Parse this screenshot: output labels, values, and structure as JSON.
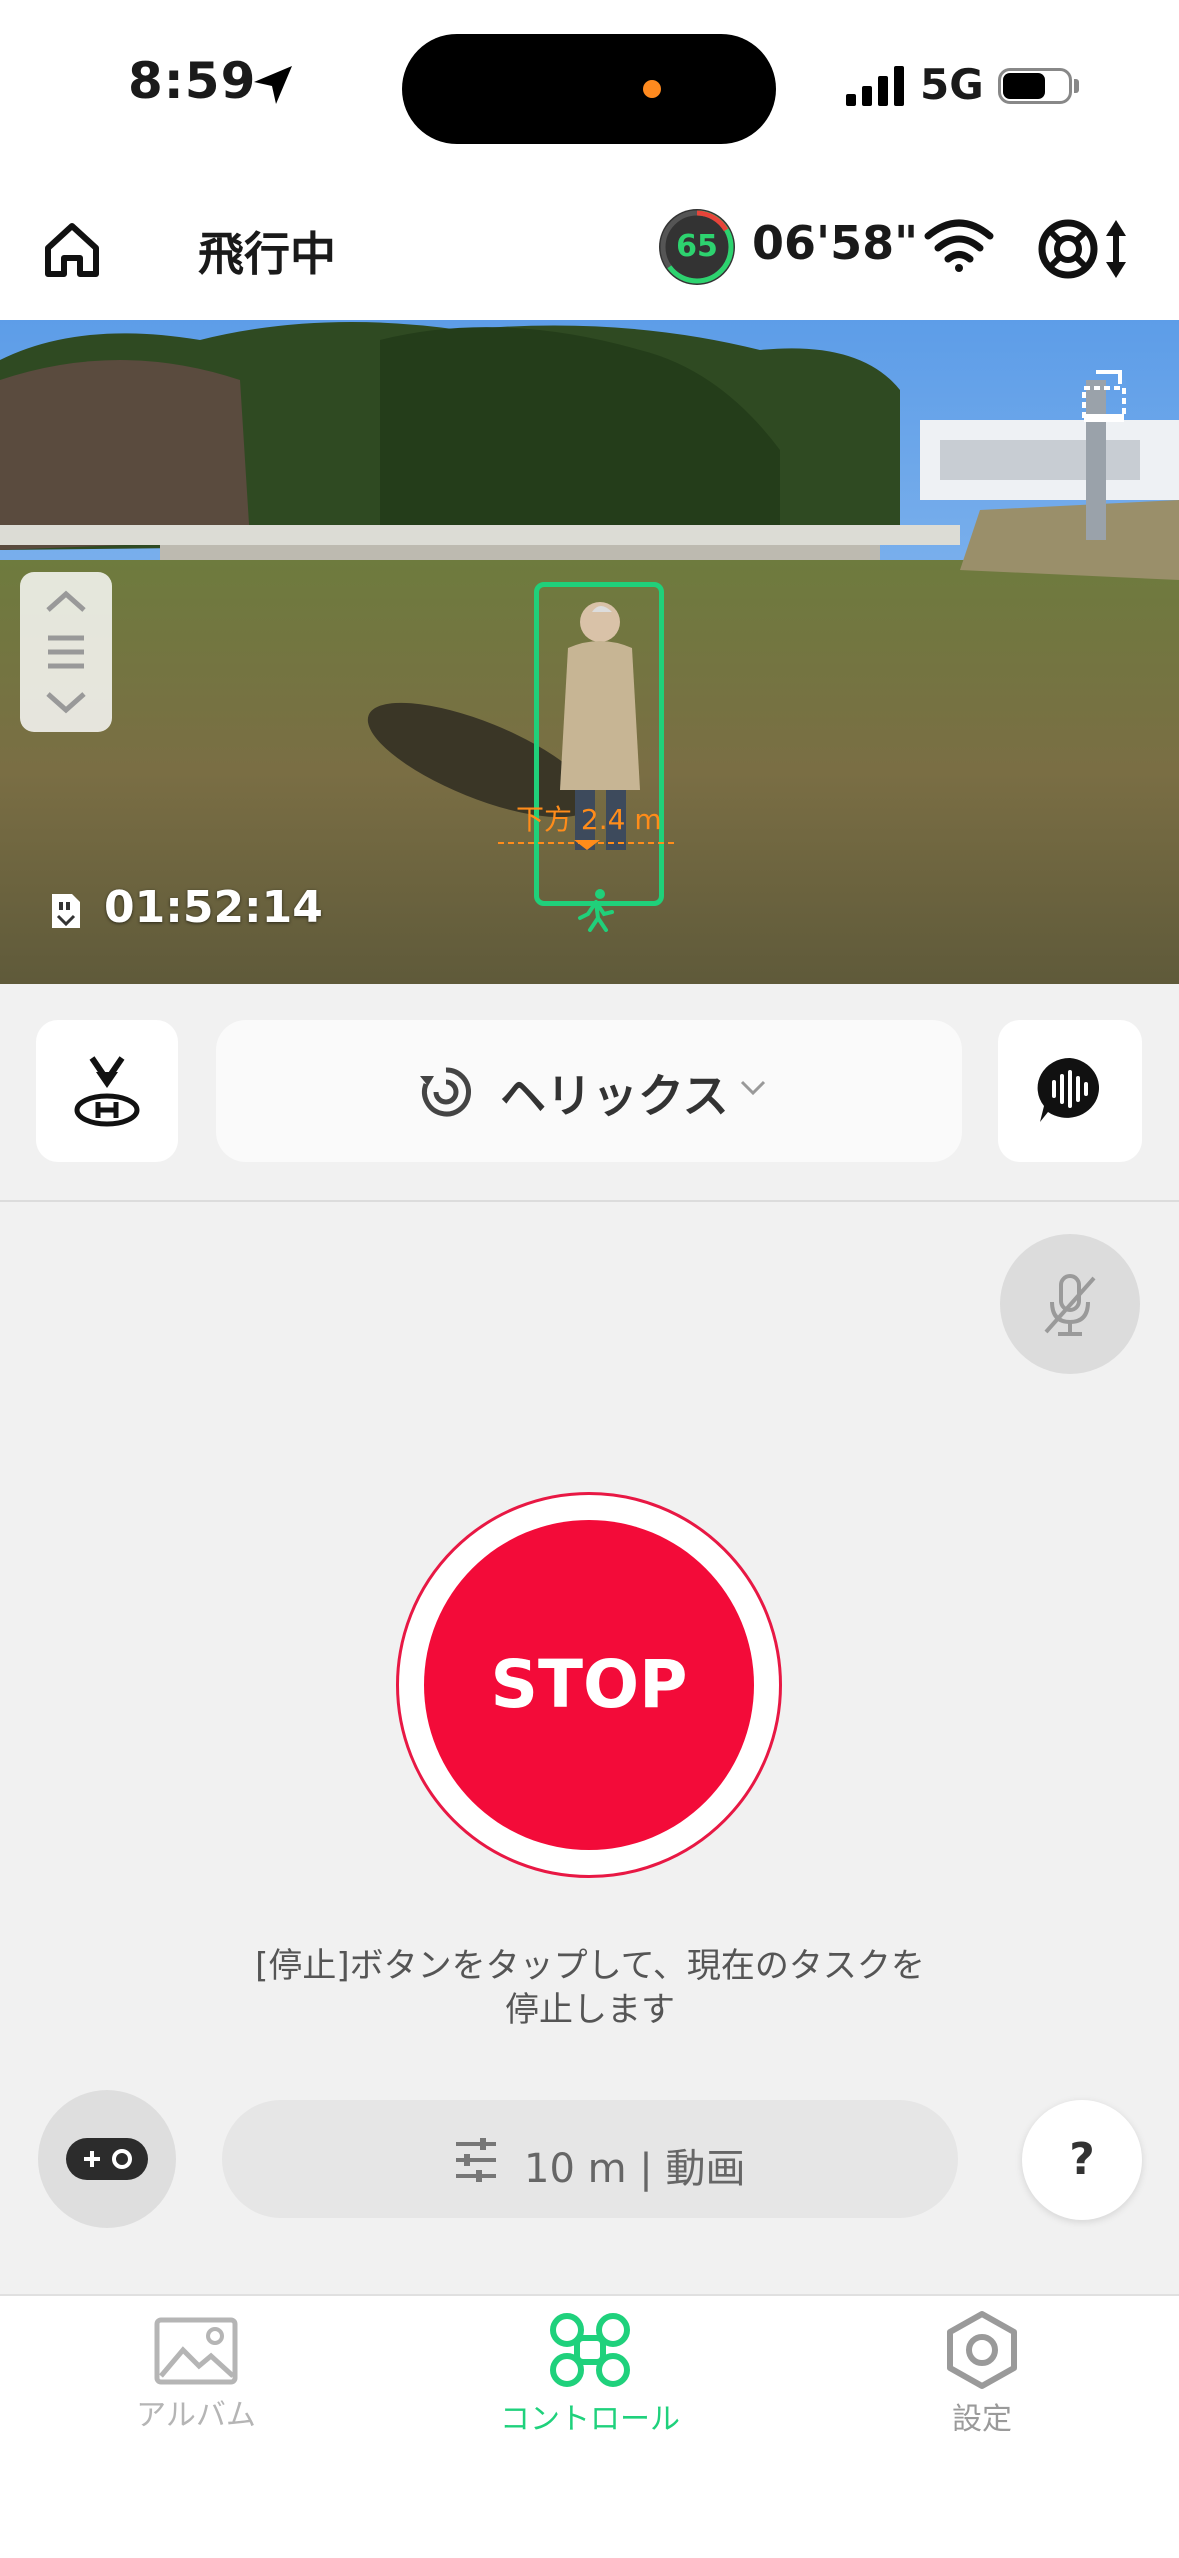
{
  "status_bar": {
    "time": "8:59",
    "network": "5G",
    "location_icon": "location-arrow-icon",
    "signal_icon": "cellular-signal-icon",
    "battery_icon": "battery-icon"
  },
  "header": {
    "flight_status": "飛行中",
    "battery_percent": "65",
    "battery_level": 0.65,
    "flight_time": "06'58\"",
    "home_icon": "home-icon",
    "wifi_icon": "wifi-icon",
    "gimbal_icon": "gimbal-control-icon"
  },
  "camera": {
    "distance_label": "下方 2.4 m",
    "recording_time": "01:52:14",
    "tracking_color": "#20d07a"
  },
  "mode_row": {
    "mode_label": "ヘリックス",
    "landing_icon": "landing-icon",
    "voice_icon": "voice-command-icon",
    "chevron_icon": "chevron-down-icon"
  },
  "control": {
    "stop_label": "STOP",
    "stop_hint_line1": "[停止]ボタンをタップして、現在のタスクを",
    "stop_hint_line2": "停止します",
    "settings_label": "10 m | 動画",
    "help_label": "?",
    "accent": "#f30b39"
  },
  "tabs": [
    {
      "label": "アルバム",
      "icon": "album-icon",
      "active": false
    },
    {
      "label": "コントロール",
      "icon": "drone-icon",
      "active": true
    },
    {
      "label": "設定",
      "icon": "settings-hexagon-icon",
      "active": false
    }
  ],
  "colors": {
    "active_tab": "#1fd17c",
    "inactive_tab": "#9a9a9a"
  }
}
